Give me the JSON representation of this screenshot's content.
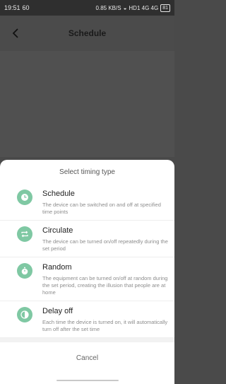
{
  "status_bar": {
    "time": "19:51",
    "indicator": "60",
    "network_speed": "0.85 KB/S",
    "signals": "HD1 4G 4G",
    "battery": "81"
  },
  "header": {
    "title": "Schedule",
    "back_icon": "chevron-left-icon"
  },
  "sheet": {
    "title": "Select timing type",
    "accent_color": "#7fc8a3",
    "options": [
      {
        "name": "Schedule",
        "desc": "The device can be switched on and off at specified time points",
        "icon": "clock-icon"
      },
      {
        "name": "Circulate",
        "desc": "The device can be turned on/off repeatedly during the set period",
        "icon": "repeat-icon"
      },
      {
        "name": "Random",
        "desc": "The equipment can be turned on/off at random during the set period, creating the illusion that people are at home",
        "icon": "stopwatch-icon"
      },
      {
        "name": "Delay off",
        "desc": "Each time the device is turned on, it will automatically turn off after the set time",
        "icon": "half-circle-icon"
      }
    ],
    "cancel_label": "Cancel"
  }
}
